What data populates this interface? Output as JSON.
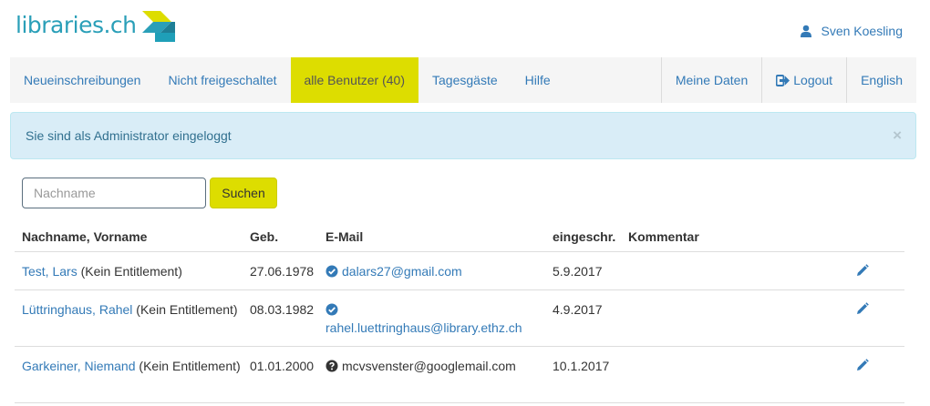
{
  "brand": {
    "logo_text": "libraries.ch",
    "logo_colors": [
      "#2a9fb8",
      "#dddd00",
      "#1f7f96"
    ]
  },
  "user": {
    "name": "Sven Koesling",
    "icon": "user-icon"
  },
  "nav": {
    "left": [
      {
        "label": "Neueinschreibungen",
        "active": false
      },
      {
        "label": "Nicht freigeschaltet",
        "active": false
      },
      {
        "label": "alle Benutzer (40)",
        "active": true
      },
      {
        "label": "Tagesgäste",
        "active": false
      },
      {
        "label": "Hilfe",
        "active": false
      }
    ],
    "right": [
      {
        "label": "Meine Daten",
        "icon": null
      },
      {
        "label": "Logout",
        "icon": "logout-icon"
      },
      {
        "label": "English",
        "icon": null
      }
    ]
  },
  "alert": {
    "message": "Sie sind als Administrator eingeloggt",
    "close": "×"
  },
  "search": {
    "placeholder": "Nachname",
    "value": "",
    "button_label": "Suchen"
  },
  "table": {
    "headers": {
      "name": "Nachname, Vorname",
      "geb": "Geb.",
      "email": "E-Mail",
      "restricted": "eingeschr.",
      "comment": "Kommentar"
    },
    "rows": [
      {
        "name_link": "Test, Lars",
        "name_suffix": " (Kein Entitlement)",
        "birth": "27.06.1978",
        "email": "dalars27@gmail.com",
        "email_status": "verified",
        "email_linked": true,
        "restricted": "5.9.2017",
        "comment": ""
      },
      {
        "name_link": "Lüttringhaus, Rahel",
        "name_suffix": " (Kein Entitlement)",
        "birth": "08.03.1982",
        "email": "rahel.luettringhaus@library.ethz.ch",
        "email_status": "verified",
        "email_linked": true,
        "restricted": "4.9.2017",
        "comment": ""
      },
      {
        "name_link": "Garkeiner, Niemand",
        "name_suffix": " (Kein Entitlement)",
        "birth": "01.01.2000",
        "email": "mcvsvenster@googlemail.com",
        "email_status": "unknown",
        "email_linked": false,
        "restricted": "10.1.2017",
        "comment": ""
      }
    ]
  },
  "colors": {
    "accent": "#dddd00",
    "link": "#337ab7",
    "alert_bg": "#d9edf7",
    "alert_text": "#31708f"
  }
}
